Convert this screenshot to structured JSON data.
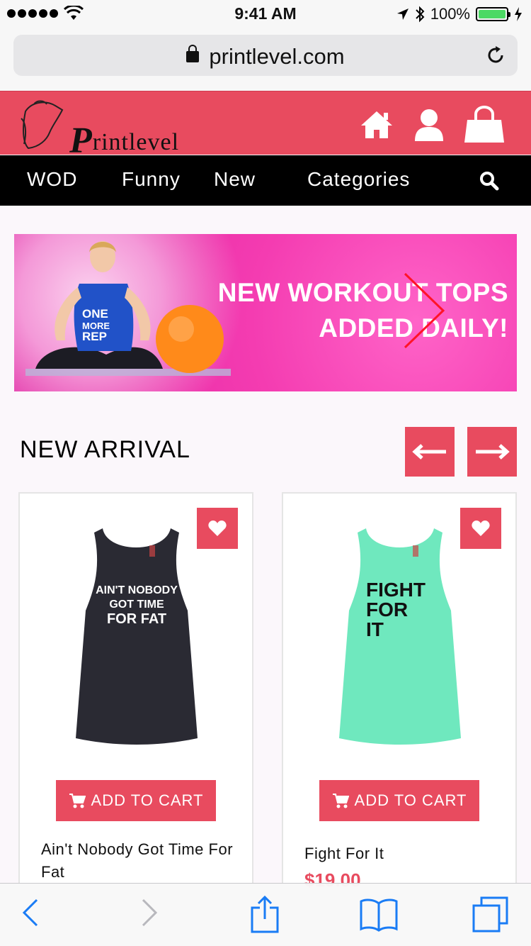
{
  "status_bar": {
    "time": "9:41 AM",
    "battery": "100%",
    "battery_level": 1.0
  },
  "browser": {
    "url": "printlevel.com"
  },
  "header": {
    "logo_cap": "P",
    "logo_rest": "rintlevel"
  },
  "nav": {
    "items": [
      "WOD",
      "Funny",
      "New",
      "Categories"
    ]
  },
  "banner": {
    "line1": "NEW WORKOUT TOPS",
    "line2": "ADDED DAILY!"
  },
  "section": {
    "title": "NEW ARRIVAL"
  },
  "products": [
    {
      "name": "Ain't Nobody Got Time For Fat",
      "cart_label": "ADD TO CART",
      "shirt_color": "#2a2a33",
      "print_color": "#ffffff",
      "print_lines": [
        "AIN'T NOBODY",
        "GOT TIME",
        "FOR FAT"
      ]
    },
    {
      "name": "Fight For It",
      "cart_label": "ADD TO CART",
      "price": "$19.00",
      "shirt_color": "#6fe8be",
      "print_color": "#111111",
      "print_lines": [
        "FIGHT",
        "FOR",
        "IT"
      ]
    }
  ],
  "colors": {
    "accent": "#e84b5f",
    "nav_bg": "#000000",
    "ios_blue": "#1a7cf5"
  }
}
